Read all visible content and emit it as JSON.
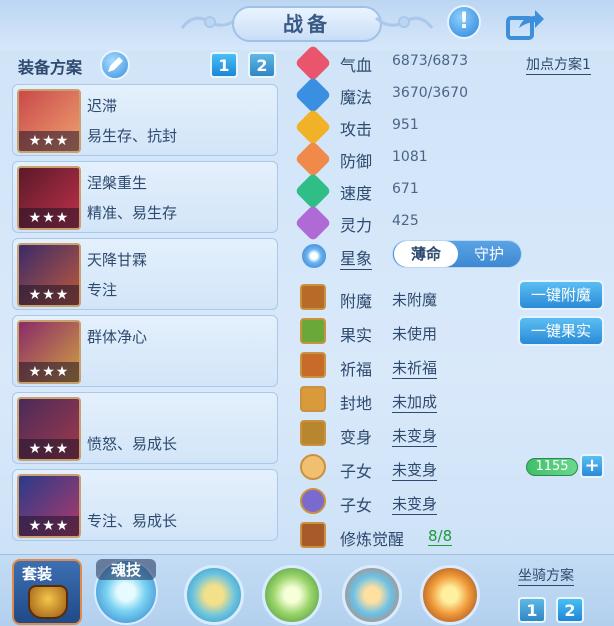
{
  "title": "战备",
  "left": {
    "heading": "装备方案",
    "tabs": [
      "1",
      "2"
    ],
    "schemes": [
      {
        "name": "迟滞",
        "tags": "易生存、抗封",
        "stars": "★★★"
      },
      {
        "name": "涅槃重生",
        "tags": "精准、易生存",
        "stars": "★★★"
      },
      {
        "name": "天降甘霖",
        "tags": "专注",
        "stars": "★★★"
      },
      {
        "name": "群体净心",
        "tags": "",
        "stars": "★★★"
      },
      {
        "name": "",
        "tags": "愤怒、易成长",
        "stars": "★★★"
      },
      {
        "name": "",
        "tags": "专注、易成长",
        "stars": "★★★"
      }
    ]
  },
  "stats": {
    "points_plan": "加点方案1",
    "rows": [
      {
        "name": "气血",
        "value": "6873/6873",
        "color": "#e8556c"
      },
      {
        "name": "魔法",
        "value": "3670/3670",
        "color": "#3b8fe0"
      },
      {
        "name": "攻击",
        "value": "951",
        "color": "#f2b227"
      },
      {
        "name": "防御",
        "value": "1081",
        "color": "#f08a4a"
      },
      {
        "name": "速度",
        "value": "671",
        "color": "#2fbf86"
      },
      {
        "name": "灵力",
        "value": "425",
        "color": "#b06ad6"
      }
    ],
    "star": {
      "label": "星象",
      "options": [
        "薄命",
        "守护"
      ]
    }
  },
  "extras": [
    {
      "name": "附魔",
      "value": "未附魔",
      "underline": false,
      "icon_color": "#b86a28"
    },
    {
      "name": "果实",
      "value": "未使用",
      "underline": false,
      "icon_color": "#6aa83a"
    },
    {
      "name": "祈福",
      "value": "未祈福",
      "underline": true,
      "icon_color": "#c86a2a"
    },
    {
      "name": "封地",
      "value": "未加成",
      "underline": true,
      "icon_color": "#d89a3a"
    },
    {
      "name": "变身",
      "value": "未变身",
      "underline": true,
      "icon_color": "#b8862e"
    },
    {
      "name": "子女",
      "value": "未变身",
      "underline": true,
      "icon_color": "#f0c070"
    },
    {
      "name": "子女",
      "value": "未变身",
      "underline": true,
      "icon_color": "#7a6ad0"
    },
    {
      "name": "修炼觉醒",
      "value": "8/8",
      "underline": false,
      "icon_color": "#a85a2a"
    }
  ],
  "buttons": {
    "enchant": "一键附魔",
    "fruit": "一键果实"
  },
  "kid_value": "1155",
  "bottom": {
    "suit": "套装",
    "soul": "魂技",
    "mount_plan": "坐骑方案",
    "mount_tabs": [
      "1",
      "2"
    ]
  }
}
